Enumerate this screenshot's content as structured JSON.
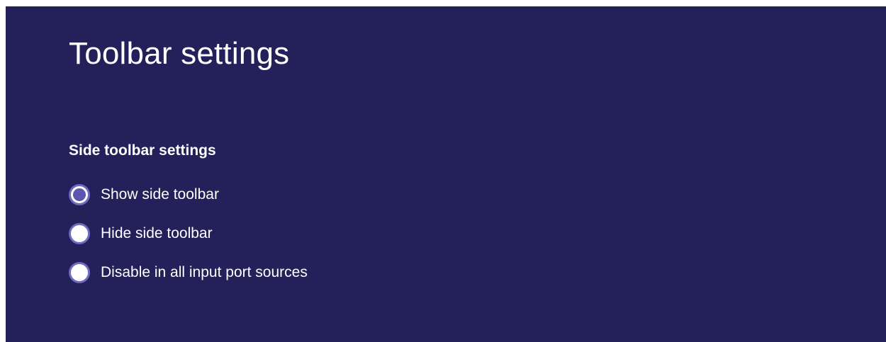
{
  "colors": {
    "background": "#24215a",
    "text": "#ffffff",
    "radio_fill": "#ffffff",
    "radio_accent": "#5a57b0"
  },
  "header": {
    "title": "Toolbar settings"
  },
  "section": {
    "title": "Side toolbar settings",
    "options": [
      {
        "label": "Show side toolbar",
        "checked": true
      },
      {
        "label": "Hide side toolbar",
        "checked": false
      },
      {
        "label": "Disable in all input port sources",
        "checked": false
      }
    ]
  }
}
